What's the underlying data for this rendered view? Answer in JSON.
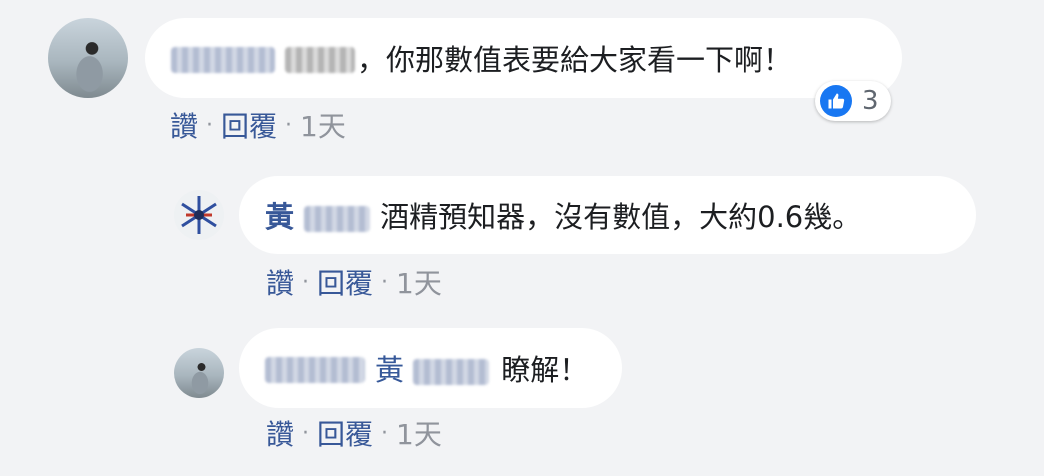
{
  "comments": [
    {
      "author_blurred": "",
      "mention_blurred": "",
      "text": "，你那數值表要給大家看一下啊！",
      "actions": {
        "like": "讚",
        "reply": "回覆",
        "time": "1天"
      },
      "reaction": {
        "icon": "thumbs-up-icon",
        "count": "3",
        "color": "#1877f2"
      }
    },
    {
      "author_visible": "黃",
      "text": "酒精預知器，沒有數值，大約0.6幾。",
      "actions": {
        "like": "讚",
        "reply": "回覆",
        "time": "1天"
      }
    },
    {
      "mention_visible": "黃",
      "text": "瞭解！",
      "actions": {
        "like": "讚",
        "reply": "回覆",
        "time": "1天"
      }
    }
  ],
  "separator": "·",
  "colors": {
    "background": "#f2f3f5",
    "link": "#385898",
    "meta": "#90949c",
    "like_blue": "#1877f2"
  }
}
